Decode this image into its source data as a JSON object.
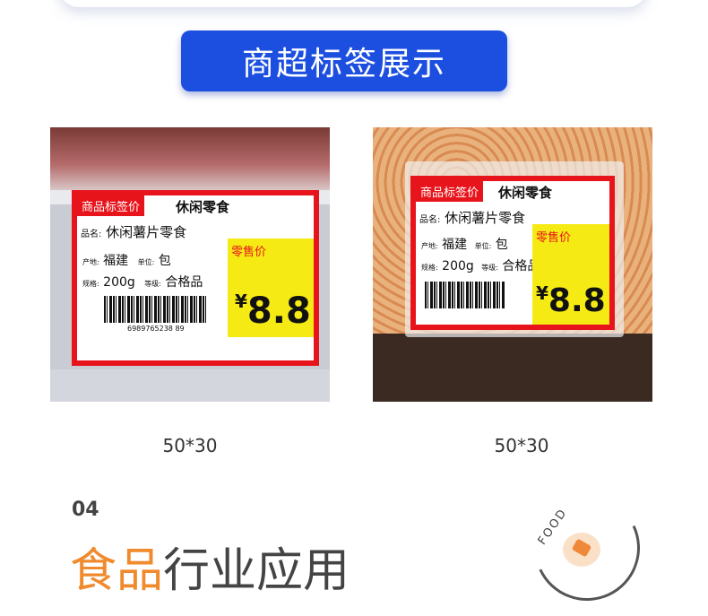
{
  "banner": {
    "title": "商超标签展示"
  },
  "labels": [
    {
      "tag": "商品标签价",
      "category": "休闲零食",
      "name_label": "品名:",
      "name": "休闲薯片零食",
      "origin_label": "产地:",
      "origin": "福建",
      "unit_label": "单位:",
      "unit": "包",
      "spec_label": "规格:",
      "spec": "200g",
      "grade_label": "等级:",
      "grade": "合格品",
      "price_title": "零售价",
      "currency": "¥",
      "price": "8.8",
      "barcode_number": "6989765238 89",
      "size": "50*30"
    },
    {
      "tag": "商品标签价",
      "category": "休闲零食",
      "name_label": "品名:",
      "name": "休闲薯片零食",
      "origin_label": "产地:",
      "origin": "福建",
      "unit_label": "单位:",
      "unit": "包",
      "spec_label": "规格:",
      "spec": "200g",
      "grade_label": "等级:",
      "grade": "合格品",
      "price_title": "零售价",
      "currency": "¥",
      "price": "8.8",
      "size": "50*30"
    }
  ],
  "section": {
    "number": "04",
    "title_accent": "食品",
    "title_rest": "行业应用",
    "badge_word": "FOOD"
  },
  "colors": {
    "banner_blue": "#1c4fe0",
    "label_red": "#e8141c",
    "price_yellow": "#f5ea13",
    "accent_orange": "#f08a2c"
  }
}
